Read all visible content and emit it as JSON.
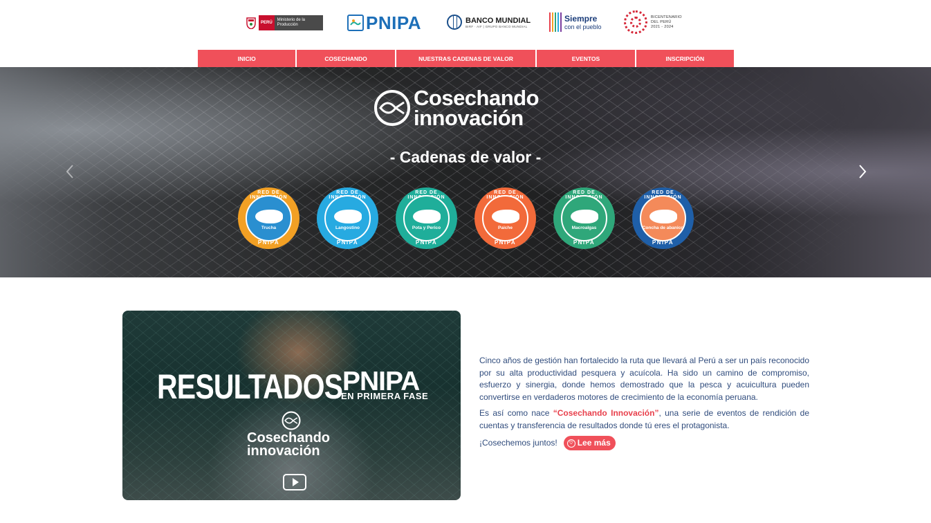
{
  "header": {
    "logos": {
      "produce": {
        "peru": "PERÚ",
        "ministry": "Ministerio de la Producción"
      },
      "pnipa": "PNIPA",
      "banco_mundial": {
        "name": "BANCO MUNDIAL",
        "sub": "BIRF · AIF | GRUPO BANCO MUNDIAL"
      },
      "siempre": {
        "line1": "Siempre",
        "line2": "con el pueblo"
      },
      "bicentenario": {
        "line1": "BICENTENARIO",
        "line2": "DEL PERÚ",
        "line3": "2021 - 2024"
      }
    }
  },
  "nav": {
    "items": [
      {
        "label": "INICIO"
      },
      {
        "label": "COSECHANDO"
      },
      {
        "label": "NUESTRAS CADENAS DE VALOR"
      },
      {
        "label": "EVENTOS"
      },
      {
        "label": "INSCRIPCIÓN"
      }
    ]
  },
  "hero": {
    "logo_line1": "Cosechando",
    "logo_line2": "innovación",
    "subtitle": "- Cadenas de valor -",
    "prev_icon": "chevron-left-icon",
    "next_icon": "chevron-right-icon",
    "badge_ring_top": "RED DE INNOVACIÓN",
    "badge_ring_bottom": "PNIPA",
    "badges": [
      {
        "name": "Trucha",
        "color": "#f2a024",
        "inner": "#2a8fd0"
      },
      {
        "name": "Langostino",
        "color": "#27aae1",
        "inner": "#27aae1"
      },
      {
        "name": "Pota y Perico",
        "color": "#1fae9a",
        "inner": "#1fae9a"
      },
      {
        "name": "Paiche",
        "color": "#f26a3a",
        "inner": "#f26a3a"
      },
      {
        "name": "Macroalgas",
        "color": "#2fa77a",
        "inner": "#2fa77a"
      },
      {
        "name": "Concha de abanico",
        "color": "#1f5fa8",
        "inner": "#f48a5a"
      }
    ]
  },
  "video": {
    "title_big": "RESULTADOS",
    "title_brand": "PNIPA",
    "title_small": "EN PRIMERA FASE",
    "logo_line1": "Cosechando",
    "logo_line2": "innovación",
    "play_icon": "play-icon"
  },
  "copy": {
    "p1": "Cinco años de gestión han fortalecido la ruta que llevará al Perú a ser un país reconocido por su alta productividad pesquera y acuícola. Ha sido un camino de compromiso, esfuerzo y sinergia, donde hemos demostrado que la pesca y acuicultura pueden convertirse en verdaderos motores de crecimiento de la economía peruana.",
    "p2_before": "Es así como nace ",
    "p2_highlight": "“Cosechando Innovación”",
    "p2_after": ", una serie de eventos de rendición de cuentas y transferencia de resultados donde tú eres el protagonista.",
    "p3": "¡Cosechemos juntos!",
    "read_more": "Lee más"
  },
  "colors": {
    "accent": "#f0505a",
    "text_blue": "#2f4b7c",
    "highlight_red": "#e8404c"
  }
}
